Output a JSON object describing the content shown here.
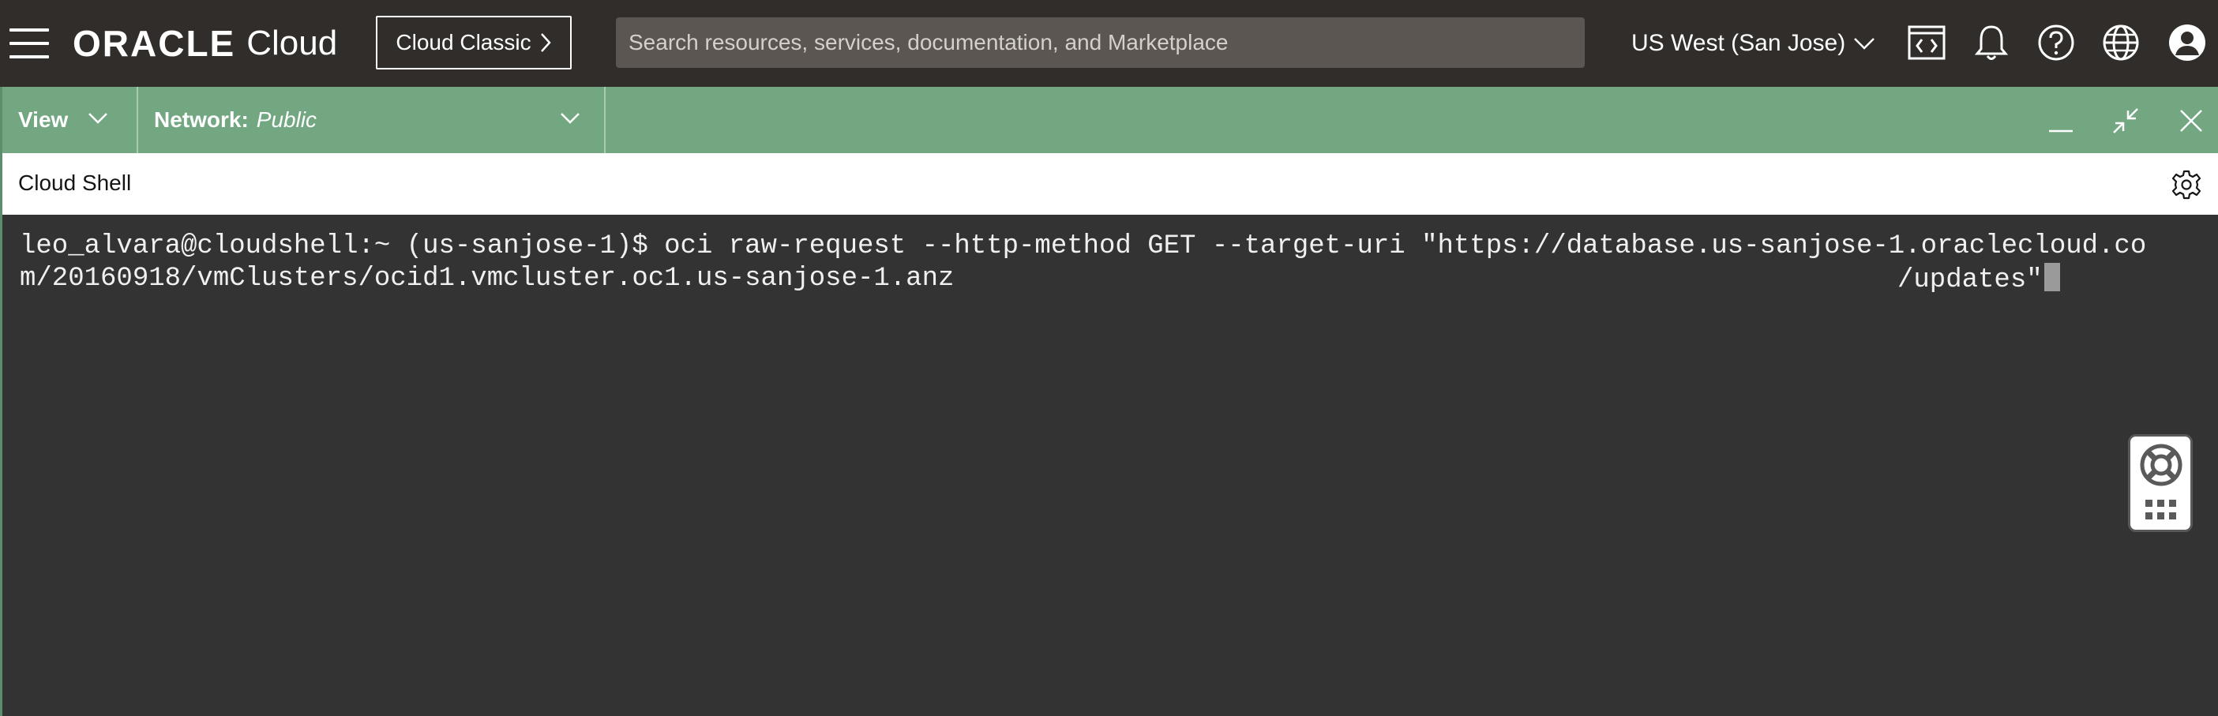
{
  "topbar": {
    "brand_oracle": "ORACLE",
    "brand_cloud": "Cloud",
    "classic_button": "Cloud Classic",
    "search_placeholder": "Search resources, services, documentation, and Marketplace",
    "region": "US West (San Jose)",
    "icons": [
      "hamburger-menu-icon",
      "code-editor-icon",
      "bell-icon",
      "help-icon",
      "globe-icon",
      "user-avatar-icon"
    ]
  },
  "cloud_shell_toolbar": {
    "view_label": "View",
    "network_label": "Network:",
    "network_value": "Public",
    "icons": [
      "minimize-icon",
      "restore-icon",
      "close-icon"
    ]
  },
  "cloud_shell": {
    "title": "Cloud Shell",
    "settings_icon": "gear-icon"
  },
  "terminal": {
    "line1": "leo_alvara@cloudshell:~ (us-sanjose-1)$ oci raw-request --http-method GET --target-uri \"https://database.us-sanjose-1.oraclecloud.co",
    "line2a": "m/20160918/vmClusters/ocid1.vmcluster.oc1.us-sanjose-1.anz",
    "line2b": "/updates\""
  },
  "help_widget": {
    "icons": [
      "lifebuoy-icon",
      "apps-grid-icon"
    ]
  },
  "colors": {
    "topbar_bg": "#312d2a",
    "green_bar": "#72a782",
    "terminal_bg": "#333333"
  }
}
